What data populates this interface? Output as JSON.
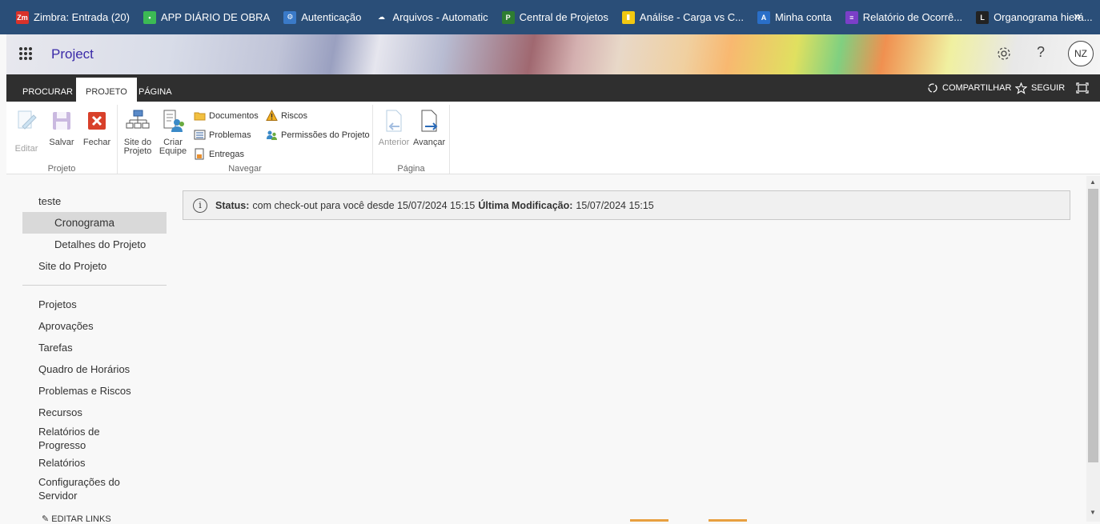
{
  "bookmarks": [
    {
      "label": "Zimbra: Entrada (20)",
      "icon": "zimbra-icon",
      "color": "#d9322a",
      "glyph": "Zm"
    },
    {
      "label": "APP DIÁRIO DE OBRA",
      "icon": "app-dot-icon",
      "color": "#3cba54",
      "glyph": "•"
    },
    {
      "label": "Autenticação",
      "icon": "gear-globe-icon",
      "color": "#3a7ac8",
      "glyph": "⚙"
    },
    {
      "label": "Arquivos - Automatic",
      "icon": "cloud-icon",
      "color": "#2a4e78",
      "glyph": "☁"
    },
    {
      "label": "Central de Projetos",
      "icon": "project-icon",
      "color": "#2e7d32",
      "glyph": "P"
    },
    {
      "label": "Análise - Carga vs C...",
      "icon": "powerbi-icon",
      "color": "#f2c811",
      "glyph": "▮"
    },
    {
      "label": "Minha conta",
      "icon": "azure-icon",
      "color": "#2a6fc8",
      "glyph": "A"
    },
    {
      "label": "Relatório de Ocorrê...",
      "icon": "forms-icon",
      "color": "#7b3fc8",
      "glyph": "≡"
    },
    {
      "label": "Organograma hierá...",
      "icon": "org-icon",
      "color": "#222222",
      "glyph": "L"
    }
  ],
  "bookmarks_more": "»",
  "suite": {
    "app_name": "Project",
    "avatar_initials": "NZ",
    "help_glyph": "?"
  },
  "tabs": {
    "procurar": "PROCURAR",
    "projeto": "PROJETO",
    "pagina": "PÁGINA",
    "share": "COMPARTILHAR",
    "follow": "SEGUIR"
  },
  "ribbon": {
    "editar": "Editar",
    "salvar": "Salvar",
    "fechar": "Fechar",
    "grp_projeto": "Projeto",
    "site_do_projeto_1": "Site do",
    "site_do_projeto_2": "Projeto",
    "criar_equipe_1": "Criar",
    "criar_equipe_2": "Equipe",
    "documentos": "Documentos",
    "problemas": "Problemas",
    "entregas": "Entregas",
    "riscos": "Riscos",
    "permissoes": "Permissões do Projeto",
    "grp_navegar": "Navegar",
    "anterior": "Anterior",
    "avancar": "Avançar",
    "grp_pagina": "Página"
  },
  "leftnav": {
    "top": [
      {
        "label": "teste",
        "sub": false,
        "selected": false
      },
      {
        "label": "Cronograma",
        "sub": true,
        "selected": true
      },
      {
        "label": "Detalhes do Projeto",
        "sub": true,
        "selected": false
      },
      {
        "label": "Site do Projeto",
        "sub": false,
        "selected": false
      }
    ],
    "bottom": [
      {
        "label": "Projetos"
      },
      {
        "label": "Aprovações"
      },
      {
        "label": "Tarefas"
      },
      {
        "label": "Quadro de Horários"
      },
      {
        "label": "Problemas e Riscos"
      },
      {
        "label": "Recursos"
      },
      {
        "label": "Relatórios de Progresso"
      },
      {
        "label": "Relatórios"
      },
      {
        "label": "Configurações do Servidor"
      }
    ],
    "edit_links": "EDITAR LINKS"
  },
  "status": {
    "status_label": "Status:",
    "status_text": "com check-out para você desde 15/07/2024 15:15",
    "modified_label": "Última Modificação:",
    "modified_text": "15/07/2024 15:15"
  }
}
